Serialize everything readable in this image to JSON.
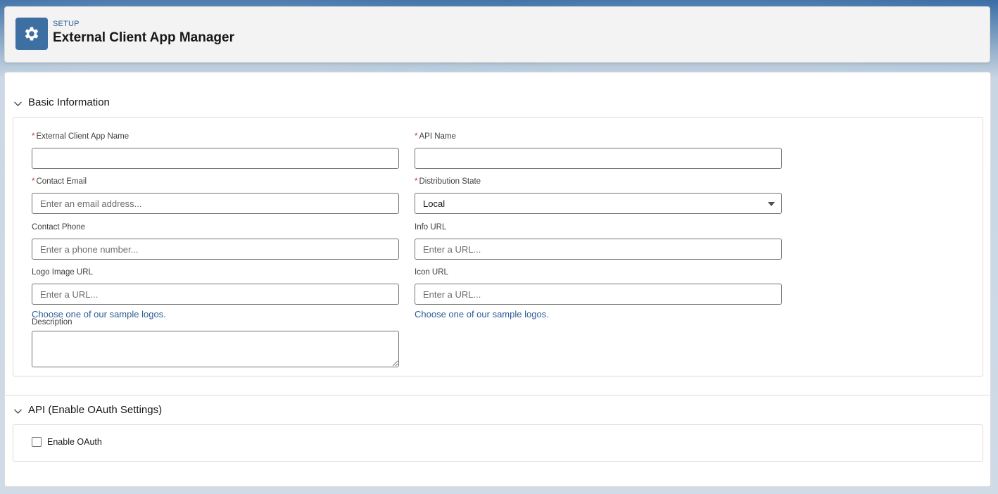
{
  "header": {
    "eyebrow": "SETUP",
    "title": "External Client App Manager",
    "icon": "gear-icon"
  },
  "basic_info": {
    "title": "Basic Information",
    "fields": {
      "app_name": {
        "label": "External Client App Name",
        "required": true,
        "value": "",
        "placeholder": ""
      },
      "api_name": {
        "label": "API Name",
        "required": true,
        "value": "",
        "placeholder": ""
      },
      "contact_email": {
        "label": "Contact Email",
        "required": true,
        "value": "",
        "placeholder": "Enter an email address..."
      },
      "distribution_state": {
        "label": "Distribution State",
        "required": true,
        "value": "Local"
      },
      "contact_phone": {
        "label": "Contact Phone",
        "required": false,
        "value": "",
        "placeholder": "Enter a phone number..."
      },
      "info_url": {
        "label": "Info URL",
        "required": false,
        "value": "",
        "placeholder": "Enter a URL..."
      },
      "logo_image_url": {
        "label": "Logo Image URL",
        "required": false,
        "value": "",
        "placeholder": "Enter a URL...",
        "helper": "Choose one of our sample logos."
      },
      "icon_url": {
        "label": "Icon URL",
        "required": false,
        "value": "",
        "placeholder": "Enter a URL...",
        "helper": "Choose one of our sample logos."
      },
      "description": {
        "label": "Description",
        "required": false,
        "value": ""
      }
    }
  },
  "api_section": {
    "title": "API (Enable OAuth Settings)",
    "enable_oauth": {
      "label": "Enable OAuth",
      "checked": false
    }
  },
  "colors": {
    "brand_blue": "#3d6fa3",
    "link_blue": "#2c5d96",
    "required_red": "#c23934"
  }
}
